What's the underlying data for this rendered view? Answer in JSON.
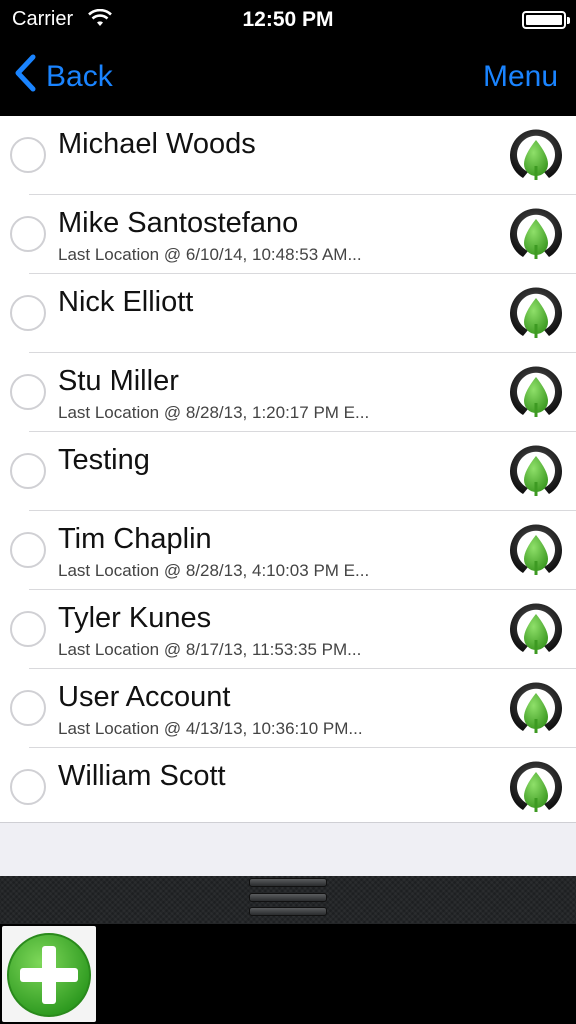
{
  "status_bar": {
    "carrier": "Carrier",
    "time": "12:50 PM",
    "wifi_icon": "wifi-icon",
    "battery_icon": "battery-icon"
  },
  "nav": {
    "back_label": "Back",
    "menu_label": "Menu"
  },
  "colors": {
    "accent": "#1a84ff",
    "leaf_green": "#5bb52f",
    "add_green": "#3aa92a"
  },
  "contacts": [
    {
      "name": "Michael Woods",
      "last_location": ""
    },
    {
      "name": "Mike Santostefano",
      "last_location": "Last Location @ 6/10/14, 10:48:53 AM..."
    },
    {
      "name": "Nick Elliott",
      "last_location": ""
    },
    {
      "name": "Stu Miller",
      "last_location": "Last Location @ 8/28/13, 1:20:17 PM E..."
    },
    {
      "name": "Testing",
      "last_location": ""
    },
    {
      "name": "Tim Chaplin",
      "last_location": "Last Location @ 8/28/13, 4:10:03 PM E..."
    },
    {
      "name": "Tyler Kunes",
      "last_location": "Last Location @ 8/17/13, 11:53:35 PM..."
    },
    {
      "name": "User Account",
      "last_location": "Last Location @ 4/13/13, 10:36:10 PM..."
    },
    {
      "name": "William Scott",
      "last_location": ""
    }
  ],
  "icons": {
    "row_logo": "leaf-logo-icon",
    "radio": "radio-circle-icon",
    "drawer_handle": "drawer-handle-icon",
    "add": "add-plus-icon"
  }
}
